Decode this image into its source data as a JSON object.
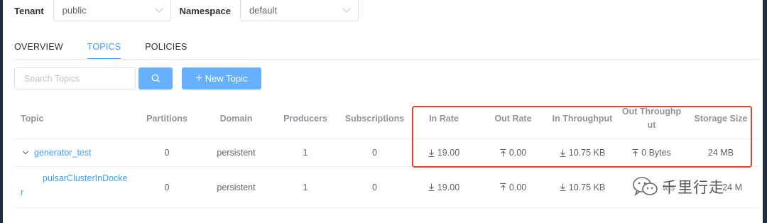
{
  "filters": {
    "tenant_label": "Tenant",
    "tenant_value": "public",
    "namespace_label": "Namespace",
    "namespace_value": "default"
  },
  "tabs": [
    {
      "label": "OVERVIEW",
      "active": false
    },
    {
      "label": "TOPICS",
      "active": true
    },
    {
      "label": "POLICIES",
      "active": false
    }
  ],
  "toolbar": {
    "search_placeholder": "Search Topics",
    "search_value": "",
    "new_topic_label": "New Topic"
  },
  "table": {
    "columns": [
      "Topic",
      "Partitions",
      "Domain",
      "Producers",
      "Subscriptions",
      "In Rate",
      "Out Rate",
      "In Throughput",
      "Out Throughput",
      "Storage Size"
    ],
    "out_throughput_lines": [
      "Out Throughp",
      "ut"
    ],
    "rows": [
      {
        "topic": "generator_test",
        "partitions": "0",
        "domain": "persistent",
        "producers": "1",
        "subscriptions": "0",
        "in_rate": "19.00",
        "out_rate": "0.00",
        "in_throughput": "10.75 KB",
        "out_throughput": "0 Bytes",
        "storage_size": "24 MB"
      },
      {
        "topic_line1": "pulsarClusterInDocke",
        "topic_line2": "r",
        "partitions": "0",
        "domain": "persistent",
        "producers": "1",
        "subscriptions": "0",
        "in_rate": "19.00",
        "out_rate": "0.00",
        "in_throughput": "10.75 KB",
        "out_throughput_partial": "tes",
        "storage_size_partial": "24 M"
      }
    ]
  },
  "watermark": {
    "text": "千里行走",
    "icon": "wechat-icon"
  },
  "colors": {
    "primary": "#409eff",
    "button": "#66b1ff",
    "highlight": "#e0452f",
    "sidebar": "#1f2d3d"
  }
}
